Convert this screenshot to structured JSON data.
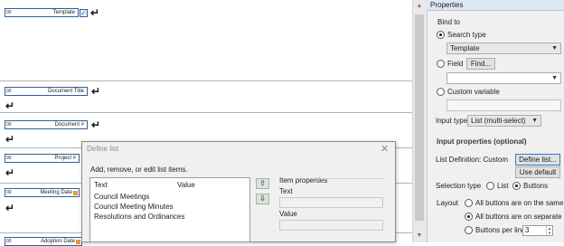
{
  "canvas": {
    "fields": [
      {
        "label": "Template",
        "tag": "00"
      },
      {
        "label": "Document Title",
        "tag": "00"
      },
      {
        "label": "Document #",
        "tag": "00"
      },
      {
        "label": "Project #",
        "tag": "00"
      },
      {
        "label": "Meeting Date",
        "tag": "00"
      },
      {
        "label": "Adoption Date",
        "tag": "00"
      }
    ],
    "enter_symbol": "↵",
    "check_symbol": "✓"
  },
  "properties": {
    "title": "Properties",
    "bind_to_label": "Bind to",
    "search_type_label": "Search type",
    "search_type_value": "Template",
    "field_label": "Field",
    "find_button": "Find...",
    "field_value": "",
    "custom_variable_label": "Custom variable",
    "custom_variable_value": "",
    "input_type_label": "Input type",
    "input_type_value": "List (multi-select)",
    "input_properties_heading": "Input properties (optional)",
    "list_definition_label": "List Definition: Custom",
    "define_list_button": "Define list...",
    "use_default_button": "Use default",
    "selection_type_label": "Selection type",
    "selection_list_label": "List",
    "selection_buttons_label": "Buttons",
    "layout_label": "Layout",
    "layout_option_same_line": "All buttons are on the same line",
    "layout_option_separate_lines": "All buttons are on separate lines",
    "layout_option_per_line": "Buttons per line",
    "buttons_per_line_value": "3",
    "bind_to_selected": "search_type",
    "selection_type_selected": "buttons",
    "layout_selected": "separate_lines"
  },
  "dialog": {
    "title": "Define list",
    "close_symbol": "✕",
    "instruction": "Add, remove, or edit list items.",
    "col_text": "Text",
    "col_value": "Value",
    "items": [
      {
        "text": "Council Meetings",
        "value": ""
      },
      {
        "text": "Council Meeting Minutes",
        "value": ""
      },
      {
        "text": "Resolutions and Ordinances",
        "value": ""
      }
    ],
    "move_up_symbol": "⇧",
    "move_down_symbol": "⇩",
    "item_properties_label": "Item properties",
    "text_label": "Text",
    "value_label": "Value"
  },
  "colors": {
    "accent": "#2d5f9e",
    "panel_bg": "#f0f0f0",
    "title_bar": "#dde6f3",
    "arrow_green": "#2f9b2f"
  }
}
